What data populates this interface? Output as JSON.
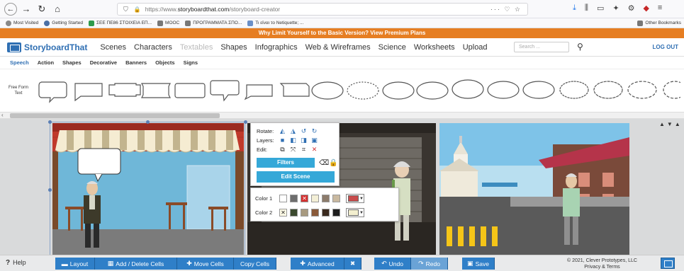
{
  "browser": {
    "url_prefix": "https://www.",
    "url_domain": "storyboardthat.com",
    "url_path": "/storyboard-creator",
    "url_actions": "··· ♡ ☆",
    "bookmarks": [
      "Most Visited",
      "Getting Started",
      "ΣΕΕ ΠΕ86 ΣΤΟΙΧΕΙΑ ΕΠ...",
      "MOOC",
      "ΠΡΟΓΡΑΜΜΑΤΑ ΣΠΟ...",
      "Τι είναι το Netiquette; ..."
    ],
    "other_bookmarks": "Other Bookmarks"
  },
  "promo": "Why Limit Yourself to the Basic Version?   View Premium Plans",
  "app": {
    "logo": "StoryboardThat",
    "nav": [
      "Scenes",
      "Characters",
      "Textables",
      "Shapes",
      "Infographics",
      "Web & Wireframes",
      "Science",
      "Worksheets",
      "Upload"
    ],
    "active_nav": "Textables",
    "search_placeholder": "Search ...",
    "logout": "LOG OUT"
  },
  "subtabs": [
    "Speech",
    "Action",
    "Shapes",
    "Decorative",
    "Banners",
    "Objects",
    "Signs"
  ],
  "bubble_label": "Free Form Text",
  "popup": {
    "rotate": "Rotate:",
    "layers": "Layers:",
    "edit": "Edit:",
    "filters": "Filters",
    "edit_scene": "Edit Scene"
  },
  "colors": {
    "color1_label": "Color 1",
    "color2_label": "Color 2",
    "color1": [
      "#ffffff",
      "#6d6d6d",
      "x-red",
      "#f3efd6",
      "#8c7b6b",
      "#c9b9a0"
    ],
    "color1_selected": "#c94c4c",
    "color2": [
      "x",
      "#3b4a2e",
      "#a89a80",
      "#8a5a3a",
      "#3a2a1e",
      "#1e1e1e"
    ],
    "color2_selected": "#f3efcf"
  },
  "toolbar": {
    "help": "Help",
    "layout": "Layout",
    "add_delete": "Add / Delete Cells",
    "move": "Move Cells",
    "copy": "Copy Cells",
    "advanced": "Advanced",
    "undo": "Undo",
    "redo": "Redo",
    "save": "Save",
    "copyright_1": "© 2021, Clever Prototypes, LLC",
    "copyright_2": "Privacy & Terms"
  }
}
